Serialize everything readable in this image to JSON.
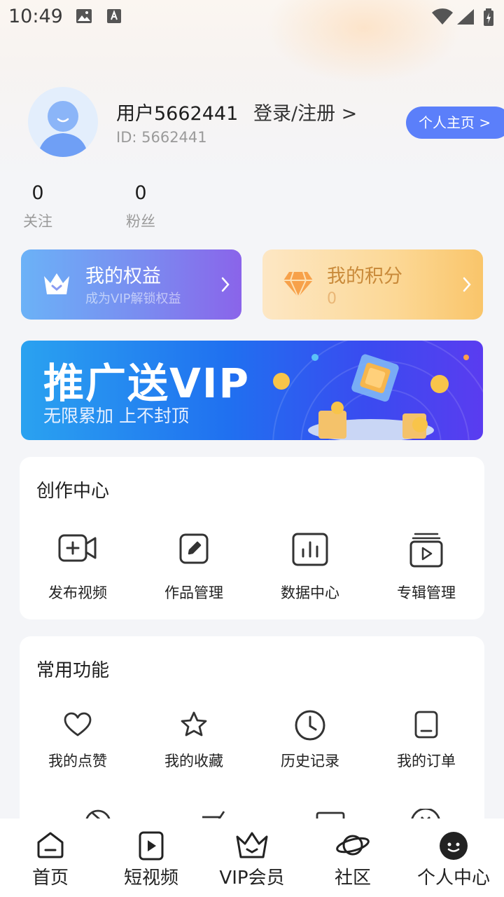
{
  "status_bar": {
    "time": "10:49"
  },
  "profile": {
    "username": "用户5662441",
    "login_link": "登录/注册 >",
    "user_id": "ID: 5662441",
    "home_button": "个人主页 >"
  },
  "stats": [
    {
      "value": "0",
      "label": "关注"
    },
    {
      "value": "0",
      "label": "粉丝"
    }
  ],
  "benefit_card": {
    "title": "我的权益",
    "subtitle": "成为VIP解锁权益"
  },
  "points_card": {
    "title": "我的积分",
    "value": "0"
  },
  "banner": {
    "title": "推广送VIP",
    "subtitle": "无限累加 上不封顶"
  },
  "creation": {
    "title": "创作中心",
    "items": [
      {
        "label": "发布视频",
        "icon": "video-add-icon"
      },
      {
        "label": "作品管理",
        "icon": "edit-icon"
      },
      {
        "label": "数据中心",
        "icon": "chart-icon"
      },
      {
        "label": "专辑管理",
        "icon": "album-icon"
      }
    ]
  },
  "common": {
    "title": "常用功能",
    "items": [
      {
        "label": "我的点赞",
        "icon": "heart-icon"
      },
      {
        "label": "我的收藏",
        "icon": "star-icon"
      },
      {
        "label": "历史记录",
        "icon": "clock-icon"
      },
      {
        "label": "我的订单",
        "icon": "order-icon"
      }
    ]
  },
  "bottom_nav": [
    {
      "label": "首页",
      "icon": "home-icon"
    },
    {
      "label": "短视频",
      "icon": "short-video-icon"
    },
    {
      "label": "VIP会员",
      "icon": "crown-icon"
    },
    {
      "label": "社区",
      "icon": "planet-icon"
    },
    {
      "label": "个人中心",
      "icon": "profile-face-icon"
    }
  ],
  "colors": {
    "accent_blue": "#5b7ffa",
    "benefit_gradient_start": "#6bb2f7",
    "benefit_gradient_end": "#8a64ea",
    "points_gradient_start": "#fde7c4",
    "points_gradient_end": "#f9c56a",
    "points_text": "#c98a3a"
  }
}
